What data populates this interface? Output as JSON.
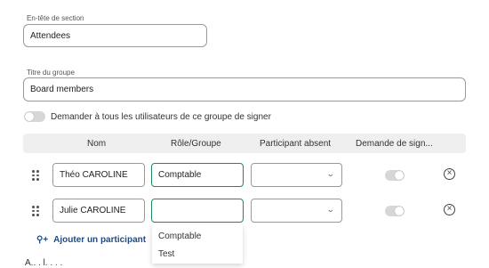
{
  "section_header": {
    "label": "En-tête de section",
    "value": "Attendees"
  },
  "group_title": {
    "label": "Titre du groupe",
    "value": "Board members"
  },
  "ask_all_signers": {
    "label": "Demander à tous les utilisateurs de ce groupe de signer",
    "enabled": false
  },
  "table": {
    "columns": [
      "Nom",
      "Rôle/Groupe",
      "Participant absent",
      "Demande de sign..."
    ],
    "rows": [
      {
        "name": "Théo CAROLINE",
        "role": "Comptable",
        "absent": "",
        "sign_request": false
      },
      {
        "name": "Julie CAROLINE",
        "role": "",
        "absent": "",
        "sign_request": false
      }
    ]
  },
  "role_dropdown": {
    "options": [
      "Comptable",
      "Test"
    ]
  },
  "add_participant": {
    "label": "Ajouter un participant",
    "icon": "add-user-icon"
  },
  "bottom_cutoff_text": "A.. . l. . . .",
  "colors": {
    "focus_green": "#1f8a5a",
    "link_blue": "#1a4c8c",
    "header_bg": "#efefef"
  }
}
